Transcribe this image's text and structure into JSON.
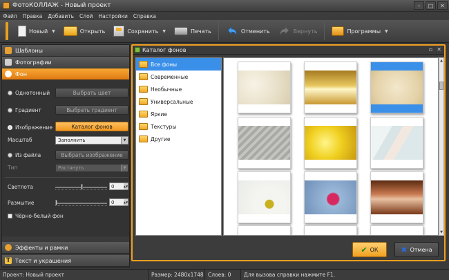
{
  "window": {
    "title": "ФотоКОЛЛАЖ - Новый проект"
  },
  "menu": [
    "Файл",
    "Правка",
    "Добавить",
    "Слой",
    "Настройки",
    "Справка"
  ],
  "toolbar": {
    "new": "Новый",
    "open": "Открыть",
    "save": "Сохранить",
    "print": "Печать",
    "undo": "Отменить",
    "redo": "Вернуть",
    "programs": "Программы"
  },
  "sidebar": {
    "templates": "Шаблоны",
    "photos": "Фотографии",
    "background": "Фон",
    "effects": "Эффекты и рамки",
    "text": "Текст и украшения"
  },
  "bg_panel": {
    "solid_label": "Однотонный",
    "choose_color": "Выбрать цвет",
    "gradient_label": "Градиент",
    "choose_gradient": "Выбрать градиент",
    "image_label": "Изображение",
    "catalog_button": "Каталог фонов",
    "scale_label": "Масштаб",
    "scale_value": "Заполнить",
    "from_file_label": "Из файла",
    "choose_image": "Выбрать изображение",
    "type_label": "Тип",
    "type_value": "Растянуть",
    "brightness_label": "Светлота",
    "brightness_value": "0",
    "blur_label": "Размытие",
    "blur_value": "0",
    "bw_label": "Чёрно-белый фон"
  },
  "dialog": {
    "title": "Каталог фонов",
    "categories": [
      "Все фоны",
      "Современные",
      "Необычные",
      "Универсальные",
      "Яркие",
      "Текстуры",
      "Другие"
    ],
    "selected_category": 0,
    "ok": "ОК",
    "cancel": "Отмена"
  },
  "statusbar": {
    "project": "Проект: Новый проект",
    "size": "Размер: 2480x1748",
    "layers": "Слоев: 0",
    "help": "Для вызова справки нажмите F1."
  },
  "colors": {
    "accent": "#f0a020",
    "selection": "#3a8fe8"
  }
}
